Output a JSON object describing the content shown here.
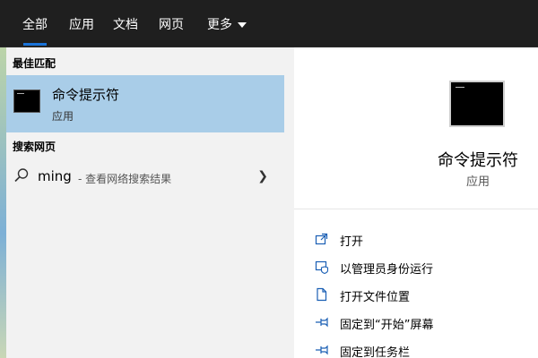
{
  "tabs": [
    {
      "label": "全部",
      "active": true
    },
    {
      "label": "应用"
    },
    {
      "label": "文档"
    },
    {
      "label": "网页"
    },
    {
      "label": "更多"
    }
  ],
  "left": {
    "best_match_heading": "最佳匹配",
    "best_match": {
      "title": "命令提示符",
      "subtitle": "应用",
      "icon": "cmd-icon"
    },
    "web_heading": "搜索网页",
    "web_result": {
      "query": "ming",
      "hint": "- 查看网络搜索结果",
      "icon": "search-icon",
      "arrow": "chevron-right-icon"
    }
  },
  "right": {
    "title": "命令提示符",
    "subtitle": "应用",
    "actions": [
      {
        "label": "打开",
        "icon": "open-icon"
      },
      {
        "label": "以管理员身份运行",
        "icon": "shield-admin-icon"
      },
      {
        "label": "打开文件位置",
        "icon": "file-location-icon"
      },
      {
        "label": "固定到“开始”屏幕",
        "icon": "pin-icon"
      },
      {
        "label": "固定到任务栏",
        "icon": "pin-icon"
      }
    ]
  },
  "colors": {
    "accent": "#1a73d9",
    "highlight": "#a9cde8",
    "topbar": "#1f1f1f",
    "left_bg": "#f2f2f2",
    "right_bg": "#ffffff"
  }
}
